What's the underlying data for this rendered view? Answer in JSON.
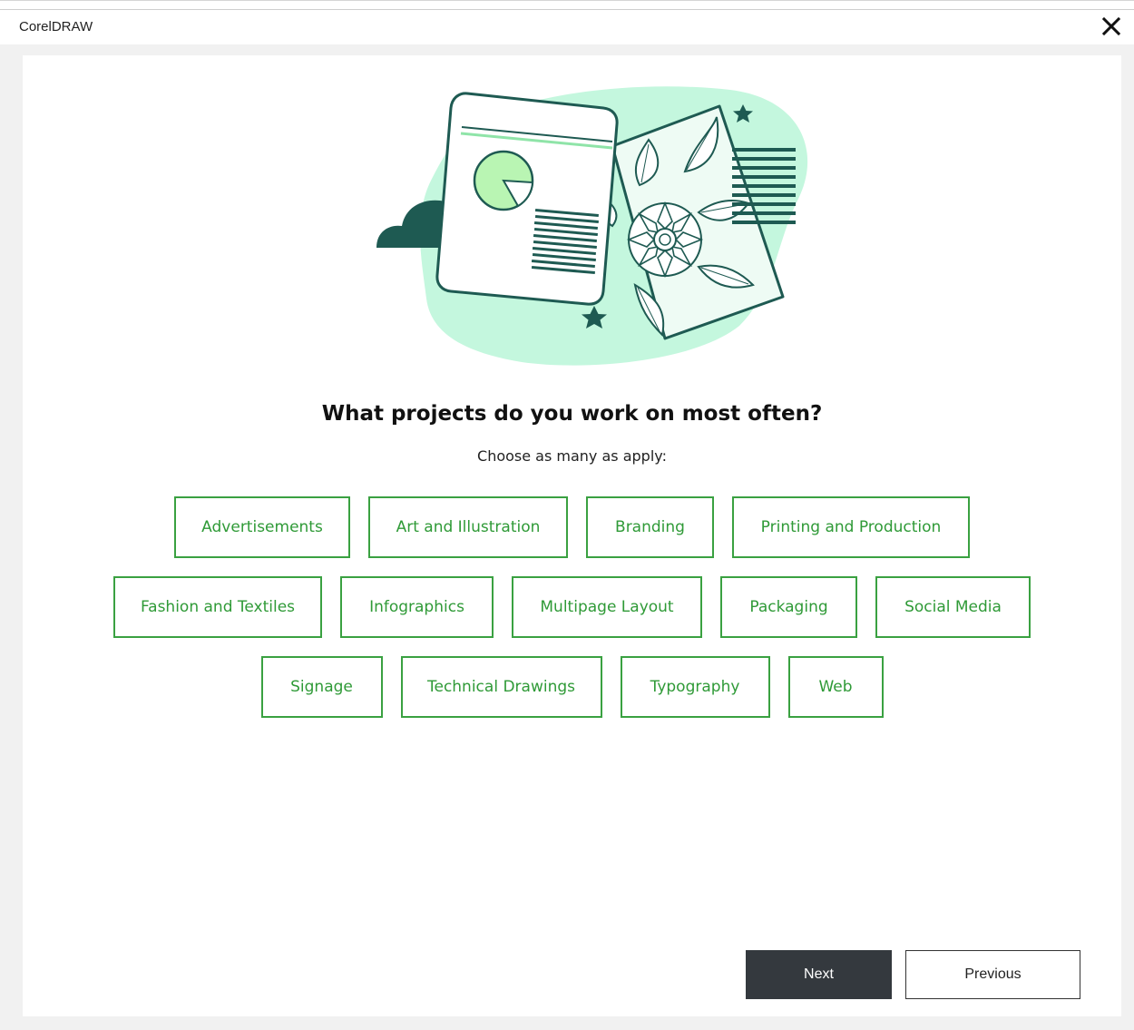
{
  "window": {
    "title": "CorelDRAW",
    "close_icon": "close-icon"
  },
  "main": {
    "heading": "What projects do you work on most often?",
    "subheading": "Choose as many as apply:",
    "options_row1": [
      "Advertisements",
      "Art and Illustration",
      "Branding",
      "Printing and Production"
    ],
    "options_row2": [
      "Fashion and Textiles",
      "Infographics",
      "Multipage Layout",
      "Packaging",
      "Social Media"
    ],
    "options_row3": [
      "Signage",
      "Technical Drawings",
      "Typography",
      "Web"
    ]
  },
  "footer": {
    "next_label": "Next",
    "previous_label": "Previous"
  },
  "colors": {
    "accent": "#3aa141",
    "dark_button": "#34393e",
    "illustration_teal": "#1e5a52",
    "illustration_mint": "#c4f7de"
  }
}
